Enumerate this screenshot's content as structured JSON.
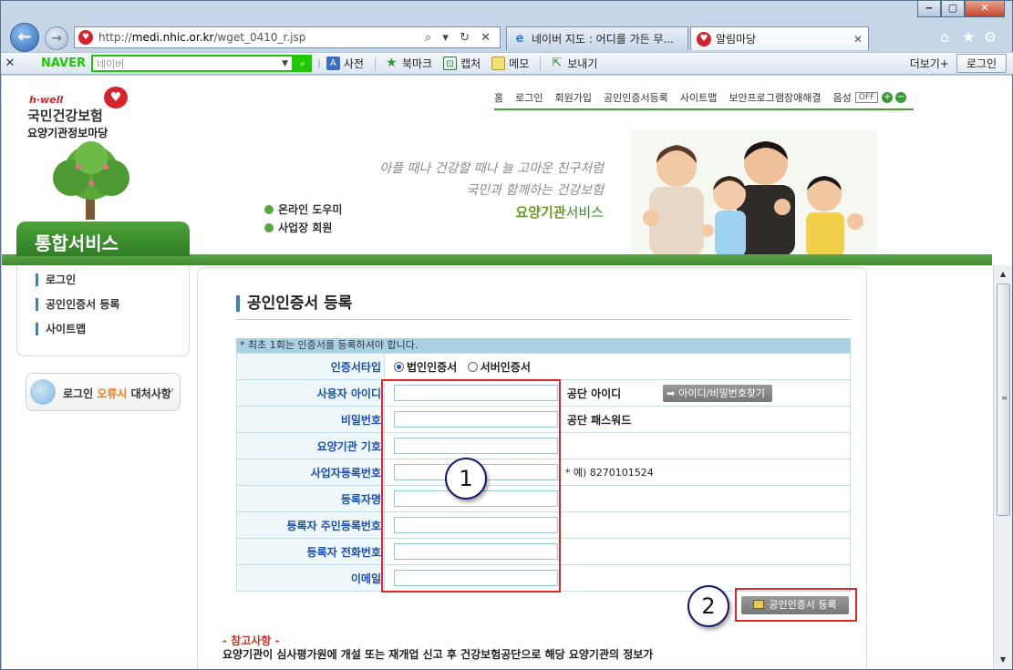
{
  "window": {
    "controls": {
      "minimize": "‒",
      "maximize": "▢",
      "close": "✕"
    }
  },
  "browser": {
    "address": "http://medi.nhic.or.kr/wget_0410_r.jsp",
    "address_dim": "http://",
    "address_host": "medi.nhic.or.kr",
    "address_path": "/wget_0410_r.jsp",
    "address_actions": "⌕ ▾ ↻ ✕",
    "tabs": [
      {
        "label": "네이버 지도 : 어디를 가든 무...",
        "icon": "ie-icon"
      },
      {
        "label": "알림마당",
        "icon": "nhis-heart-icon"
      }
    ],
    "tab_close": "✕",
    "right_icons": [
      "home-icon",
      "favorites-icon",
      "gear-icon"
    ]
  },
  "naver_toolbar": {
    "close": "✕",
    "brand": "NAVER",
    "search_placeholder": "네이버",
    "items": [
      "사전",
      "북마크",
      "캡처",
      "메모",
      "보내기"
    ],
    "more": "더보기+",
    "login": "로그인"
  },
  "site": {
    "logo_hwell": "h·well",
    "logo_main": "국민건강보험",
    "logo_sub": "요양기관정보마당",
    "gnb": [
      "홈",
      "로그인",
      "회원가입",
      "공인인증서등록",
      "사이트맵",
      "보안프로그램장애해결",
      "음성"
    ],
    "voice_off": "OFF",
    "voice_plus": "+",
    "voice_minus": "−",
    "slogan_line1": "아플 때나 건강할 때나 늘 고마운 친구처럼",
    "slogan_line2": "국민과 함께하는 건강보험",
    "slogan_brand_a": "요양기관",
    "slogan_brand_b": "서비스",
    "quick_links": [
      "온라인 도우미",
      "사업장 회원"
    ],
    "service_tab": "통합서비스"
  },
  "lnb": {
    "items": [
      "로그인",
      "공인인증서 등록",
      "사이트맵"
    ],
    "banner_pre": "로그인 ",
    "banner_em": "오류시",
    "banner_post": " 대처사항",
    "banner_arrow": "›"
  },
  "form": {
    "title": "공인인증서 등록",
    "notice": "* 최초 1회는 인증서를 등록하셔야 합니다.",
    "cert_type_label": "인증서타입",
    "cert_type_options": [
      "법인인증서",
      "서버인증서"
    ],
    "selected_option": "법인인증서",
    "user_id_label": "사용자 아이디",
    "user_id_side": "공단 아이디",
    "find_button": "아이디/비밀번호찾기",
    "password_label": "비밀번호",
    "password_side": "공단 패스워드",
    "institution_label": "요양기관 기호",
    "bizno_label": "사업자등록번호",
    "bizno_hint": "* 예) 8270101524",
    "registrant_label": "등록자명",
    "registrant_rrn_label": "등록자 주민등록번호",
    "registrant_phone_label": "등록자 전화번호",
    "email_label": "이메일",
    "register_button": "공인인증서 등록",
    "ref_title": "- 참고사항 -",
    "ref_body": "요양기관이 심사평가원에 개설 또는 재개업 신고 후 건강보험공단으로 해당 요양기관의 정보가"
  },
  "annotations": {
    "callout_1": "1",
    "callout_2": "2"
  },
  "scrollbar": {
    "up": "▲",
    "down": "▼",
    "grip": "≡"
  },
  "colors": {
    "accent_green": "#3f8a31",
    "label_blue": "#1a4fb0",
    "annotation_red": "#e0262a",
    "brand_red": "#d5232a"
  }
}
